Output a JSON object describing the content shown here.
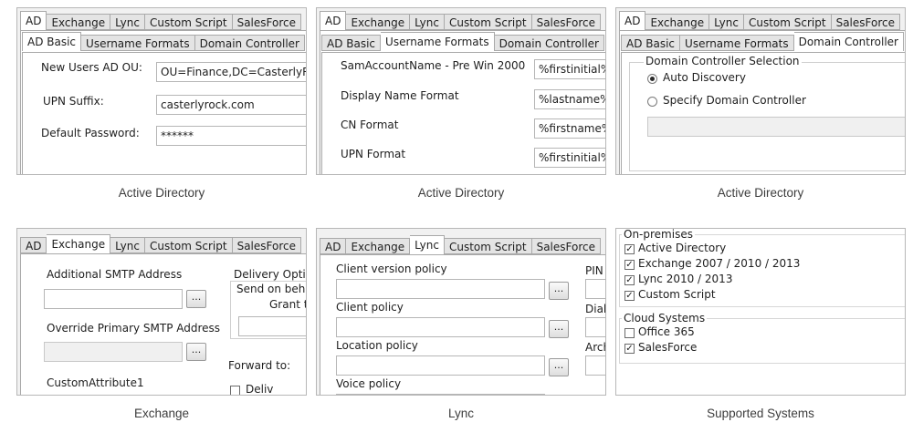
{
  "main_tabs": [
    "AD",
    "Exchange",
    "Lync",
    "Custom Script",
    "SalesForce"
  ],
  "ad_sub_tabs": [
    "AD Basic",
    "Username Formats",
    "Domain Controller"
  ],
  "ad_basic": {
    "caption": "Active Directory",
    "new_ou_label": "New Users AD OU:",
    "new_ou_value": "OU=Finance,DC=CasterlyRock",
    "upn_label": "UPN Suffix:",
    "upn_value": "casterlyrock.com",
    "pwd_label": "Default Password:",
    "pwd_value": "******"
  },
  "username_formats": {
    "caption": "Active Directory",
    "sam_label": "SamAccountName - Pre Win 2000",
    "sam_value": "%firstinitial%%",
    "display_label": "Display Name Format",
    "display_value": "%lastname%, %",
    "cn_label": "CN Format",
    "cn_value": "%firstname% %",
    "upn_label": "UPN Format",
    "upn_value": "%firstinitial%%"
  },
  "domain_controller": {
    "caption": "Active Directory",
    "group_title": "Domain Controller Selection",
    "auto_label": "Auto Discovery",
    "specify_label": "Specify Domain Controller"
  },
  "exchange": {
    "caption": "Exchange",
    "smtp_label": "Additional SMTP Address",
    "override_label": "Override Primary SMTP Address",
    "custom_attr_label": "CustomAttribute1",
    "delivery_label": "Delivery Optio",
    "send_on_behalf_label": "Send on beha",
    "grant_label": "Grant th",
    "forward_label": "Forward to:",
    "deliver_label": "Deliv",
    "ellipsis": "..."
  },
  "lync": {
    "caption": "Lync",
    "client_version_label": "Client version policy",
    "client_label": "Client policy",
    "location_label": "Location policy",
    "voice_label": "Voice policy",
    "pin_label": "PIN",
    "dial_label": "Dial",
    "arch_label": "Arch",
    "ellipsis": "..."
  },
  "supported": {
    "caption": "Supported Systems",
    "onprem_title": "On-premises",
    "onprem_items": [
      {
        "label": "Active Directory",
        "checked": true
      },
      {
        "label": "Exchange 2007 / 2010 / 2013",
        "checked": true
      },
      {
        "label": "Lync 2010 / 2013",
        "checked": true
      },
      {
        "label": "Custom Script",
        "checked": true
      }
    ],
    "cloud_title": "Cloud Systems",
    "cloud_items": [
      {
        "label": "Office 365",
        "checked": false
      },
      {
        "label": "SalesForce",
        "checked": true
      }
    ],
    "check_glyph": "✓"
  }
}
